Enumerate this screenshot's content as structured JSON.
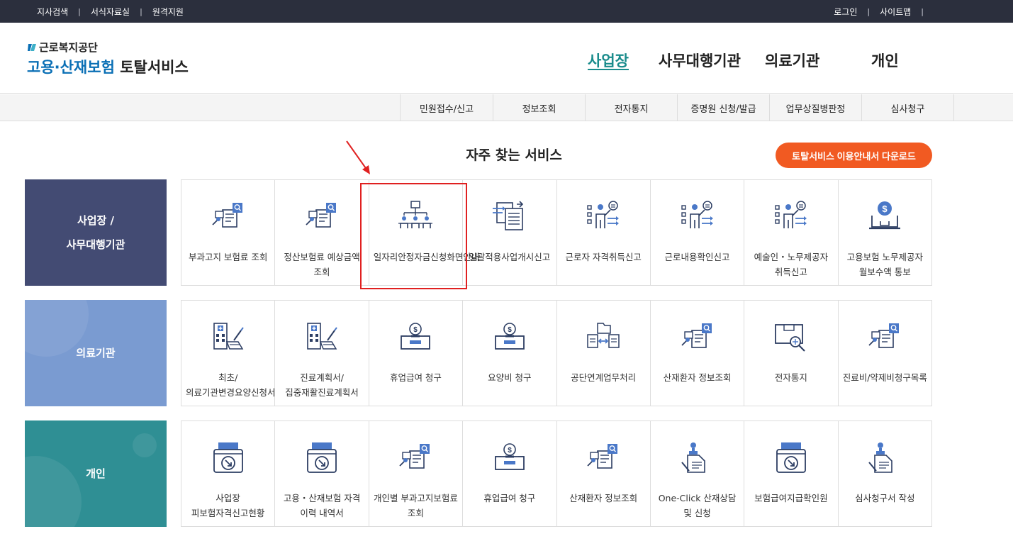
{
  "topbar": {
    "left": [
      "지사검색",
      "서식자료실",
      "원격지원"
    ],
    "right": [
      "로그인",
      "사이트맵"
    ]
  },
  "logo": {
    "org": "근로복지공단",
    "svc_main": "고용·산재보험",
    "svc_rest": "토탈서비스"
  },
  "gnb": [
    "사업장",
    "사무대행기관",
    "의료기관",
    "개인"
  ],
  "subnav": [
    "민원접수/신고",
    "정보조회",
    "전자통지",
    "증명원 신청/발급",
    "업무상질병판정",
    "심사청구"
  ],
  "section_title": "자주 찾는 서비스",
  "download_button": "토탈서비스 이용안내서 다운로드",
  "rows": {
    "business": {
      "label": "사업장 /\n사무대행기관",
      "items": [
        {
          "label": "부과고지 보험료 조회",
          "icon": "document-search-icon"
        },
        {
          "label": "정산보험료 예상금액 조회",
          "icon": "document-search-icon"
        },
        {
          "label": "일자리안정자금신청화면안내",
          "icon": "org-chart-icon"
        },
        {
          "label": "일괄적용사업개시신고",
          "icon": "document-transfer-icon"
        },
        {
          "label": "근로자 자격취득신고",
          "icon": "person-checklist-icon"
        },
        {
          "label": "근로내용확인신고",
          "icon": "person-checklist-icon"
        },
        {
          "label": "예술인・노무제공자 취득신고",
          "icon": "person-checklist-icon"
        },
        {
          "label": "고용보험 노무제공자 월보수액 통보",
          "icon": "money-laptop-icon"
        }
      ]
    },
    "medical": {
      "label": "의료기관",
      "items": [
        {
          "label": "최초/의료기관변경요양신청서",
          "icon": "hospital-document-icon"
        },
        {
          "label": "진료계획서/집중재활진료계획서",
          "icon": "hospital-document-icon"
        },
        {
          "label": "휴업급여 청구",
          "icon": "coin-box-icon"
        },
        {
          "label": "요양비 청구",
          "icon": "coin-box-icon"
        },
        {
          "label": "공단연계업무처리",
          "icon": "folder-exchange-icon"
        },
        {
          "label": "산재환자 정보조회",
          "icon": "document-search-icon"
        },
        {
          "label": "전자통지",
          "icon": "box-search-icon"
        },
        {
          "label": "진료비/약제비청구목록",
          "icon": "document-search-icon"
        }
      ]
    },
    "individual": {
      "label": "개인",
      "items": [
        {
          "label": "사업장 피보험자격신고현황",
          "icon": "printer-download-icon"
        },
        {
          "label": "고용・산재보험 자격 이력 내역서",
          "icon": "printer-download-icon"
        },
        {
          "label": "개인별 부과고지보험료 조회",
          "icon": "document-search-icon"
        },
        {
          "label": "휴업급여 청구",
          "icon": "coin-box-icon"
        },
        {
          "label": "산재환자 정보조회",
          "icon": "document-search-icon"
        },
        {
          "label": "One-Click 산재상담 및 신청",
          "icon": "stamp-document-icon"
        },
        {
          "label": "보험급여지급확인원",
          "icon": "printer-download-icon"
        },
        {
          "label": "심사청구서 작성",
          "icon": "stamp-document-icon"
        }
      ]
    }
  },
  "colors": {
    "topbar": "#2b2f3d",
    "accent": "#1a8c8c",
    "download": "#f15a22",
    "business": "#434b73",
    "medical": "#7a9bd1",
    "individual": "#2f8f94",
    "icon_dark": "#2d3e63",
    "icon_blue": "#4a78c8",
    "highlight": "#e02020"
  }
}
